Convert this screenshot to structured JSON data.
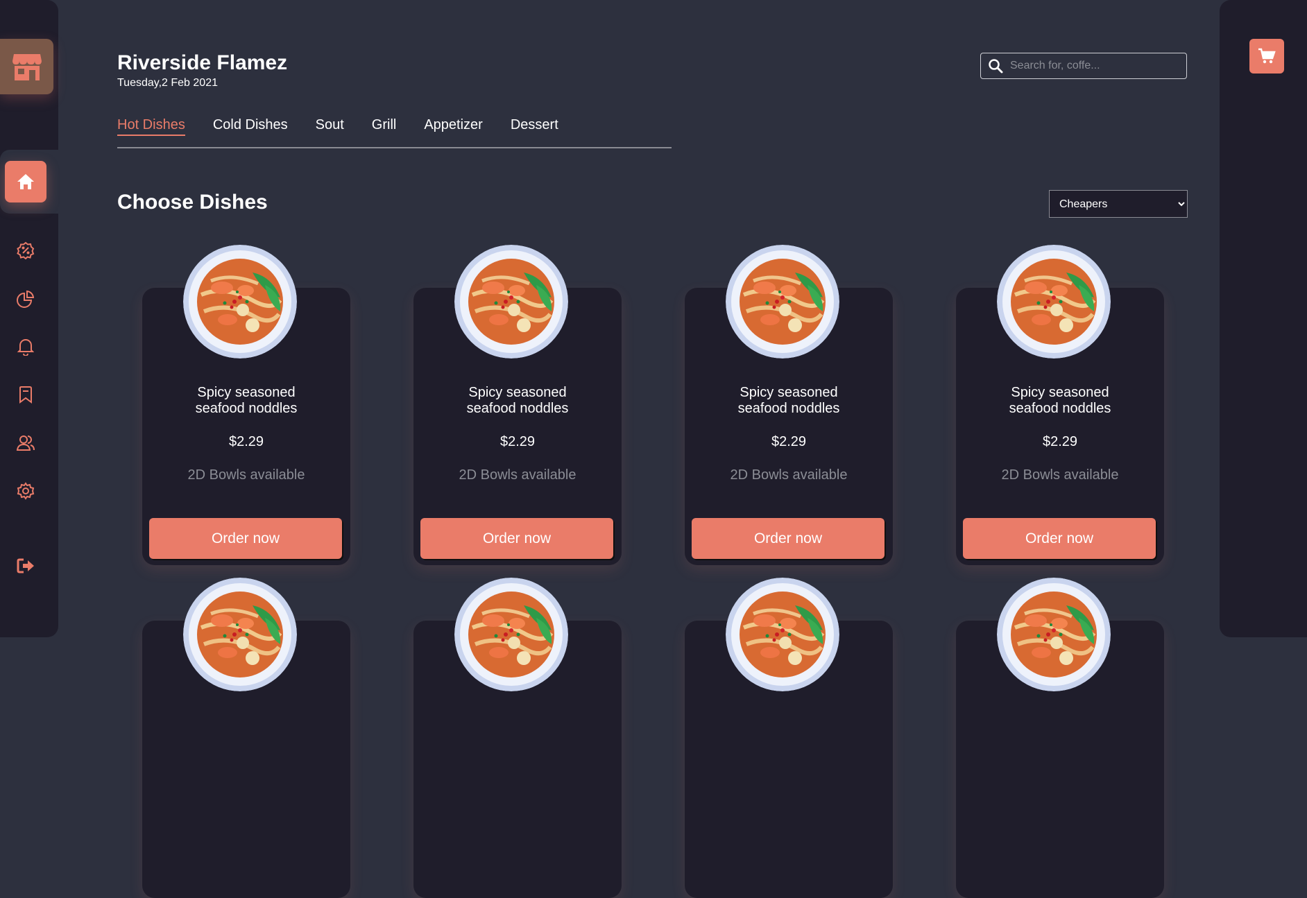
{
  "brand": {
    "title": "Riverside Flamez",
    "date": "Tuesday,2 Feb 2021",
    "logo_icon": "store-icon"
  },
  "search": {
    "placeholder": "Search for, coffe..."
  },
  "tabs": [
    {
      "label": "Hot Dishes",
      "active": true
    },
    {
      "label": "Cold Dishes",
      "active": false
    },
    {
      "label": "Sout",
      "active": false
    },
    {
      "label": "Grill",
      "active": false
    },
    {
      "label": "Appetizer",
      "active": false
    },
    {
      "label": "Dessert",
      "active": false
    }
  ],
  "section": {
    "title": "Choose Dishes"
  },
  "sort": {
    "selected": "Cheapers"
  },
  "sidebar": {
    "items": [
      {
        "icon": "home-icon",
        "active": true
      },
      {
        "icon": "discount-icon"
      },
      {
        "icon": "dashboard-icon"
      },
      {
        "icon": "notification-icon"
      },
      {
        "icon": "bookmark-icon"
      },
      {
        "icon": "users-icon"
      },
      {
        "icon": "settings-icon"
      },
      {
        "icon": "logout-icon"
      }
    ]
  },
  "dishes": [
    {
      "name": "Spicy seasoned seafood noddles",
      "price": "$2.29",
      "availability": "2D Bowls available",
      "order_label": "Order now"
    },
    {
      "name": "Spicy seasoned seafood noddles",
      "price": "$2.29",
      "availability": "2D Bowls available",
      "order_label": "Order now"
    },
    {
      "name": "Spicy seasoned seafood noddles",
      "price": "$2.29",
      "availability": "2D Bowls available",
      "order_label": "Order now"
    },
    {
      "name": "Spicy seasoned seafood noddles",
      "price": "$2.29",
      "availability": "2D Bowls available",
      "order_label": "Order now"
    }
  ],
  "colors": {
    "accent": "#ea7c69",
    "background": "#2d303e",
    "panel": "#1f1d2b",
    "muted_text": "#8b8d95"
  }
}
